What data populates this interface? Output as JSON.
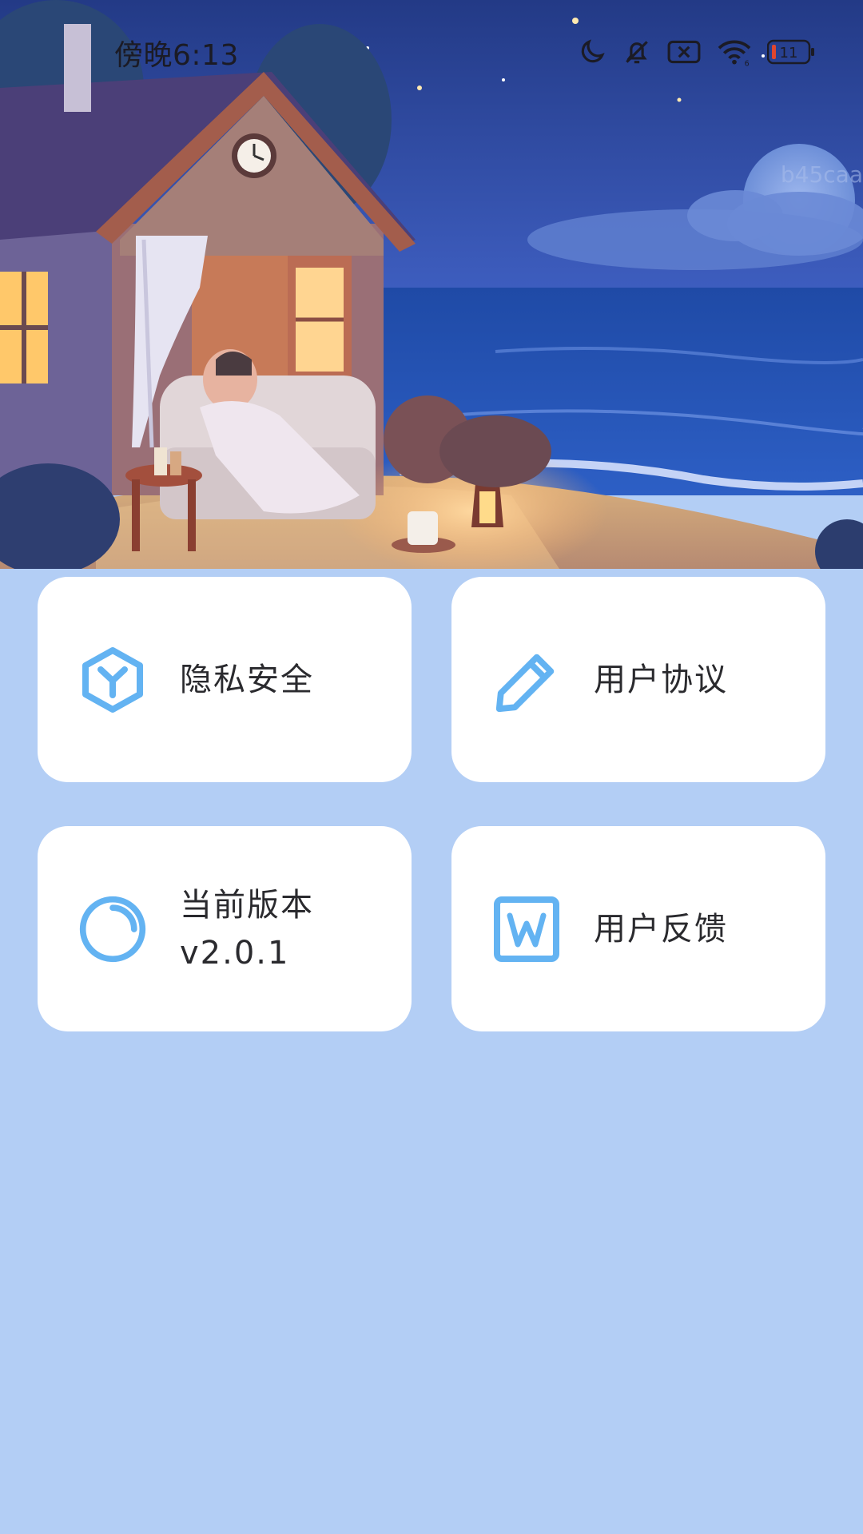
{
  "status_bar": {
    "time": "傍晚6:13",
    "battery_level": "11",
    "icons": [
      "moon-icon",
      "bell-off-icon",
      "sim-off-icon",
      "wifi-icon",
      "battery-icon"
    ]
  },
  "hero": {
    "watermark": "b45caa",
    "image_icon": "house-by-the-sea-illustration"
  },
  "cards": {
    "privacy": {
      "label": "隐私安全",
      "icon": "hexagon-y-icon"
    },
    "agreement": {
      "label": "用户协议",
      "icon": "pencil-icon"
    },
    "version": {
      "label": "当前版本",
      "value": "v2.0.1",
      "icon": "refresh-circle-icon"
    },
    "feedback": {
      "label": "用户反馈",
      "icon": "w-square-icon"
    }
  },
  "colors": {
    "background": "#b3cef5",
    "card": "#ffffff",
    "accent_icon": "#63b3f2",
    "text": "#2a2a2e"
  }
}
